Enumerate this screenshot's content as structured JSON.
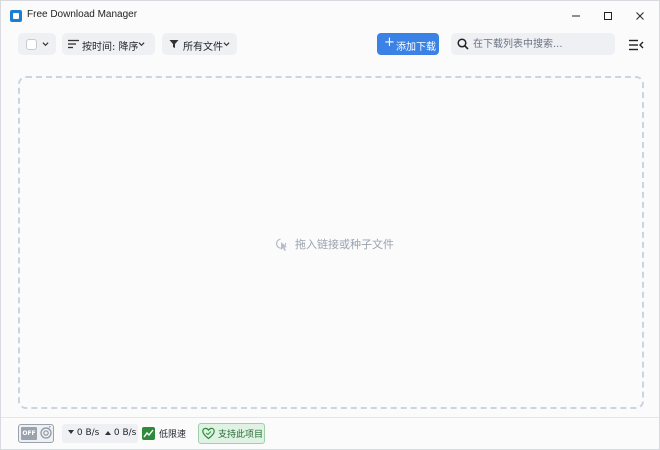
{
  "window": {
    "title": "Free Download Manager"
  },
  "toolbar": {
    "sort_label": "按时间: 降序",
    "filter_label": "所有文件",
    "add_label": "添加下载",
    "add_plus": "+",
    "search_placeholder": "在下载列表中搜索..."
  },
  "main": {
    "drop_hint": "拖入链接或种子文件"
  },
  "statusbar": {
    "toggle_label": "OFF",
    "download_speed": "0 B/s",
    "upload_speed": "0 B/s",
    "limit_label": "低限速",
    "support_label": "支持此项目"
  },
  "colors": {
    "accent": "#3b82e6",
    "support_bg": "#dff2e3",
    "limit_green": "#2f8a3c"
  },
  "icons": {
    "app": "fdm-logo-icon",
    "sort": "sort-lines-icon",
    "filter": "funnel-icon",
    "search": "search-icon",
    "menu": "hamburger-menu-icon",
    "drop": "pointer-click-icon",
    "limit": "speed-chart-icon",
    "support": "heart-icon"
  }
}
